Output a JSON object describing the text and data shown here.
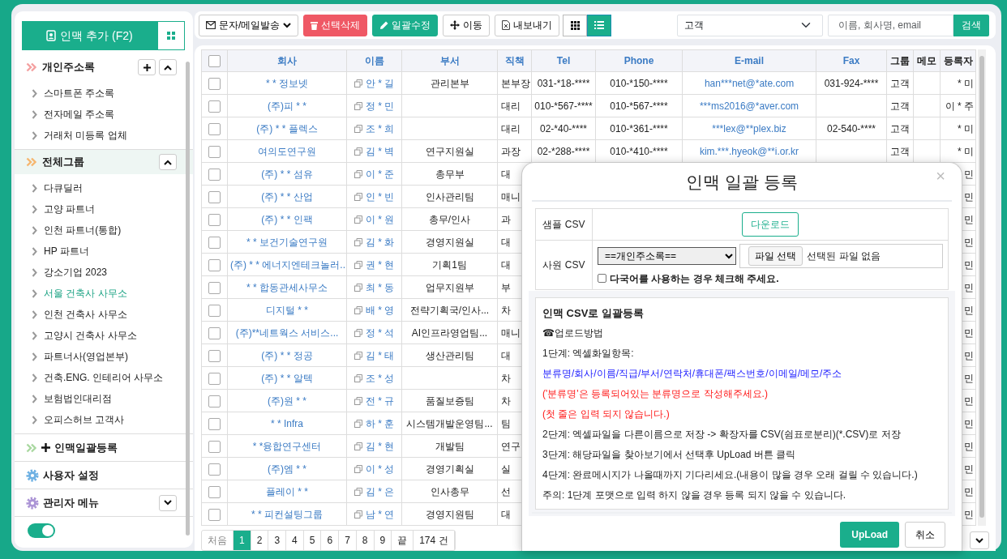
{
  "sidebar": {
    "add_button": "인맥 추가 (F2)",
    "sections": [
      {
        "title": "개인주소록",
        "color": "#f4a0a0",
        "selected": false,
        "expanded": true,
        "can_add": true,
        "items": [
          {
            "label": "스마트폰 주소록",
            "selected": false
          },
          {
            "label": "전자메일 주소록",
            "selected": false
          },
          {
            "label": "거래처 미등록 업체",
            "selected": false
          }
        ]
      },
      {
        "title": "전체그룹",
        "color": "#f6b66f",
        "selected": true,
        "expanded": true,
        "can_add": false,
        "items": [
          {
            "label": "다큐딜러",
            "selected": false
          },
          {
            "label": "고양 파트너",
            "selected": false
          },
          {
            "label": "인천 파트너(통합)",
            "selected": false
          },
          {
            "label": "HP 파트너",
            "selected": false
          },
          {
            "label": "강소기업 2023",
            "selected": false
          },
          {
            "label": "서울 건축사 사무소",
            "selected": true
          },
          {
            "label": "인천 건축사 사무소",
            "selected": false
          },
          {
            "label": "고양시 건축사 사무소",
            "selected": false
          },
          {
            "label": "파트너사(영업본부)",
            "selected": false
          },
          {
            "label": "건축.ENG. 인테리어 사무소",
            "selected": false
          },
          {
            "label": "보험법인대리점",
            "selected": false
          },
          {
            "label": "오피스허브 고객사",
            "selected": false
          }
        ]
      }
    ],
    "links": [
      {
        "kind": "bulk",
        "label": "인맥일괄등록"
      },
      {
        "kind": "user",
        "label": "사용자 설정"
      },
      {
        "kind": "admin",
        "label": "관리자 메뉴",
        "expanded": false
      }
    ],
    "toggle": {
      "on": true
    }
  },
  "toolbar": {
    "buttons": [
      {
        "kind": "dropdown",
        "label": "문자/메일발송"
      },
      {
        "kind": "delete",
        "label": "선택삭제"
      },
      {
        "kind": "edit",
        "label": "일괄수정"
      },
      {
        "kind": "move",
        "label": "이동"
      },
      {
        "kind": "export",
        "label": "내보내기"
      }
    ],
    "views": [
      {
        "kind": "grid",
        "selected": false
      },
      {
        "kind": "list",
        "selected": true
      }
    ],
    "group_select": "고객",
    "search": {
      "placeholder": "이름, 회사명, email",
      "button": "검색"
    }
  },
  "table": {
    "select_all": {
      "checked": false
    },
    "columns": [
      {
        "label": "회사",
        "sortable": true
      },
      {
        "label": "이름",
        "sortable": true
      },
      {
        "label": "부서",
        "sortable": true
      },
      {
        "label": "직책",
        "sortable": true
      },
      {
        "label": "Tel",
        "sortable": true
      },
      {
        "label": "Phone",
        "sortable": true
      },
      {
        "label": "E-mail",
        "sortable": true
      },
      {
        "label": "Fax",
        "sortable": true
      },
      {
        "label": "그룹",
        "sortable": false
      },
      {
        "label": "메모",
        "sortable": false
      },
      {
        "label": "등록자",
        "sortable": false
      }
    ],
    "rows": [
      {
        "checked": false,
        "company": "* * 정보넷",
        "name": "안 * 길",
        "dept": "관리본부",
        "title": "본부장",
        "tel": "031-*18-****",
        "phone": "010-*150-****",
        "email": "han***net@*ate.com",
        "fax": "031-924-****",
        "group": "고객",
        "registrant": "* 미"
      },
      {
        "checked": false,
        "company": "(주)피 * *",
        "name": "정 * 민",
        "title": "대리",
        "tel": "010-*567-****",
        "phone": "010-*567-****",
        "email": "***ms2016@*aver.com",
        "group": "고객",
        "registrant": "이 * 주"
      },
      {
        "checked": false,
        "company": "(주) * * 플렉스",
        "name": "조 * 희",
        "title": "대리",
        "tel": "02-*40-****",
        "phone": "010-*361-****",
        "email": "***lex@**plex.biz",
        "fax": "02-540-****",
        "group": "고객",
        "registrant": "* 미"
      },
      {
        "checked": false,
        "company": "여의도연구원",
        "name": "김 * 벽",
        "dept": "연구지원실",
        "title": "과장",
        "tel": "02-*288-****",
        "phone": "010-*410-****",
        "email": "kim.***.hyeok@**i.or.kr",
        "group": "고객",
        "registrant": "* 미"
      },
      {
        "checked": false,
        "company": "(주) * * 섬유",
        "name": "이 * 준",
        "dept": "총무부",
        "title": "대",
        "registrant": "민"
      },
      {
        "checked": false,
        "company": "(주) * * 산업",
        "name": "인 * 빈",
        "dept": "인사관리팀",
        "title": "매니",
        "registrant": "민"
      },
      {
        "checked": false,
        "company": "(주) * * 인팩",
        "name": "이 * 원",
        "dept": "총무/인사",
        "title": "과",
        "registrant": "민"
      },
      {
        "checked": false,
        "company": "* * 보건기술연구원",
        "name": "김 * 화",
        "dept": "경영지원실",
        "title": "대",
        "registrant": "민"
      },
      {
        "checked": false,
        "company": "(주) * * 에너지엔테크놀러..",
        "name": "권 * 현",
        "dept": "기획1팀",
        "title": "대",
        "registrant": "민"
      },
      {
        "checked": false,
        "company": "* * 합동관세사무소",
        "name": "최 * 동",
        "dept": "업무지원부",
        "title": "부",
        "registrant": "민"
      },
      {
        "checked": false,
        "company": "디지털 * *",
        "name": "배 * 영",
        "dept": "전략기획국/인사...",
        "title": "차",
        "registrant": "민"
      },
      {
        "checked": false,
        "company": "(주)**네트웍스 서비스...",
        "name": "정 * 석",
        "dept": "AI인프라영업팀...",
        "title": "매니",
        "registrant": "민"
      },
      {
        "checked": false,
        "company": "(주) * * 정공",
        "name": "김 * 태",
        "dept": "생산관리팀",
        "title": "대",
        "registrant": "민"
      },
      {
        "checked": false,
        "company": "(주) * * 알텍",
        "name": "조 * 성",
        "title": "차",
        "registrant": "민"
      },
      {
        "checked": false,
        "company": "(주)원 * *",
        "name": "전 * 규",
        "dept": "품질보증팀",
        "title": "차",
        "registrant": "민"
      },
      {
        "checked": false,
        "company": "* * Infra",
        "name": "하 * 훈",
        "dept": "시스템개발운영팀...",
        "title": "팀",
        "registrant": "민"
      },
      {
        "checked": false,
        "company": "* *융합연구센터",
        "name": "김 * 현",
        "dept": "개발팀",
        "title": "연구",
        "registrant": "민"
      },
      {
        "checked": false,
        "company": "(주)엠 * *",
        "name": "이 * 성",
        "dept": "경영기획실",
        "title": "실",
        "registrant": "민"
      },
      {
        "checked": false,
        "company": "플레이 * *",
        "name": "김 * 은",
        "dept": "인사총무",
        "title": "선",
        "registrant": "민"
      },
      {
        "checked": false,
        "company": "* * 피컨설팅그룹",
        "name": "남 * 연",
        "dept": "경영지원팀",
        "title": "대",
        "registrant": "민"
      }
    ]
  },
  "pagination": {
    "first": "처음",
    "pages": [
      {
        "label": "1",
        "selected": true
      },
      {
        "label": "2",
        "selected": false
      },
      {
        "label": "3",
        "selected": false
      },
      {
        "label": "4",
        "selected": false
      },
      {
        "label": "5",
        "selected": false
      },
      {
        "label": "6",
        "selected": false
      },
      {
        "label": "7",
        "selected": false
      },
      {
        "label": "8",
        "selected": false
      },
      {
        "label": "9",
        "selected": false
      }
    ],
    "last": "끝",
    "total": "174 건"
  },
  "modal": {
    "title": "인맥 일괄 등록",
    "close": "×",
    "sample_label": "샘플 CSV",
    "download_button": "다운로드",
    "employee_label": "사원 CSV",
    "group_select": "==개인주소록==",
    "file_button": "파일 선택",
    "file_status": "선택된 파일 없음",
    "multilingual": {
      "label": "다국어를 사용하는 경우 체크해 주세요.",
      "checked": false
    },
    "lines": [
      {
        "kind": "heading",
        "text": "인맥 CSV로 일괄등록"
      },
      {
        "kind": "plain",
        "text": "☎업로드방법"
      },
      {
        "kind": "plain",
        "text": "1단계: 엑셀화일항목:"
      },
      {
        "kind": "fields",
        "text": "분류명/회사/이름/직급/부서/연락처/휴대폰/팩스번호/이메일/메모/주소"
      },
      {
        "kind": "warning",
        "text": "('분류명'은 등록되어있는 분류명으로 작성해주세요.)"
      },
      {
        "kind": "warning",
        "text": "(첫 줄은 입력 되지 않습니다.)"
      },
      {
        "kind": "plain",
        "text": "2단계: 엑셀파일을 다른이름으로 저장 -> 확장자를 CSV(쉼표로분리)(*.CSV)로 저장"
      },
      {
        "kind": "plain",
        "text": "3단계: 해당파일을 찾아보기에서 선택후 UpLoad 버튼 클릭"
      },
      {
        "kind": "plain",
        "text": "4단계: 완료메시지가 나올때까지 기다리세요.(내용이 많을 경우 오래 걸릴 수 있습니다.)"
      },
      {
        "kind": "plain",
        "text": "주의: 1단계 포맷으로 입력 하지 않을 경우 등록 되지 않을 수 있습니다."
      }
    ],
    "upload_button": "UpLoad",
    "cancel_button": "취소"
  }
}
